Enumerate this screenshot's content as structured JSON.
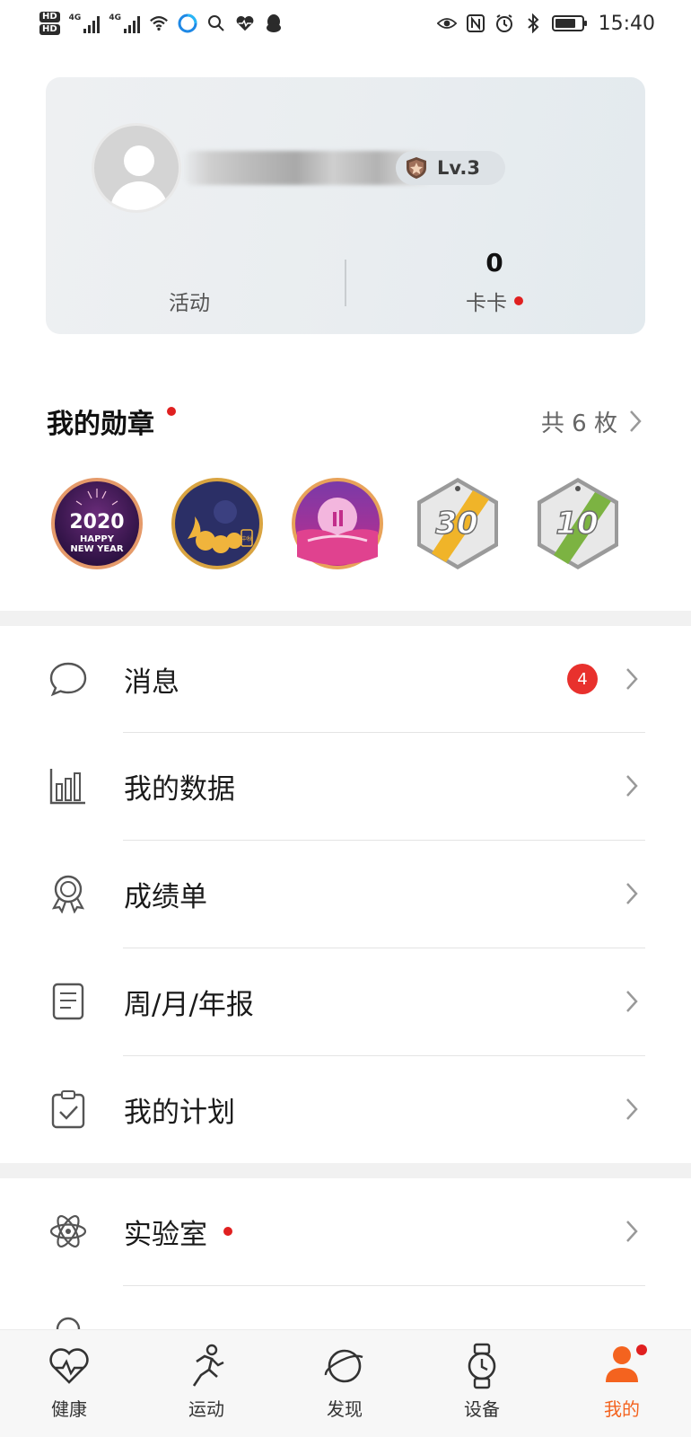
{
  "status_bar": {
    "hd_labels": [
      "HD",
      "HD"
    ],
    "network_labels": [
      "4G",
      "4G"
    ],
    "battery_level": 0.8,
    "time": "15:40"
  },
  "profile": {
    "level": "Lv.3",
    "activity_label": "活动",
    "kaka_value": "0",
    "kaka_label": "卡卡"
  },
  "medals": {
    "title": "我的勋章",
    "count_text": "共 6 枚",
    "items": [
      {
        "name": "2020 happy new year",
        "text_line1": "2020",
        "text_line2": "HAPPY",
        "text_line3": "NEW YEAR"
      },
      {
        "name": "mid-autumn",
        "seal_text": "中秋"
      },
      {
        "name": "qixi"
      },
      {
        "name": "30 km",
        "number": "30"
      },
      {
        "name": "10 km",
        "number": "10"
      }
    ]
  },
  "menu": {
    "items": [
      {
        "label": "消息",
        "badge": "4",
        "icon": "message-icon"
      },
      {
        "label": "我的数据",
        "icon": "bar-chart-icon"
      },
      {
        "label": "成绩单",
        "icon": "award-icon"
      },
      {
        "label": "周/月/年报",
        "icon": "report-icon"
      },
      {
        "label": "我的计划",
        "icon": "plan-clipboard-icon"
      }
    ],
    "items2": [
      {
        "label": "实验室",
        "icon": "atom-icon",
        "red_dot": true
      }
    ]
  },
  "tabs": [
    {
      "label": "健康",
      "icon": "heart-icon"
    },
    {
      "label": "运动",
      "icon": "running-icon"
    },
    {
      "label": "发现",
      "icon": "planet-icon"
    },
    {
      "label": "设备",
      "icon": "watch-icon"
    },
    {
      "label": "我的",
      "icon": "person-icon",
      "active": true
    }
  ],
  "colors": {
    "accent": "#f4631f",
    "badge_red": "#e8312d",
    "card_bg": "#e9edf0"
  }
}
